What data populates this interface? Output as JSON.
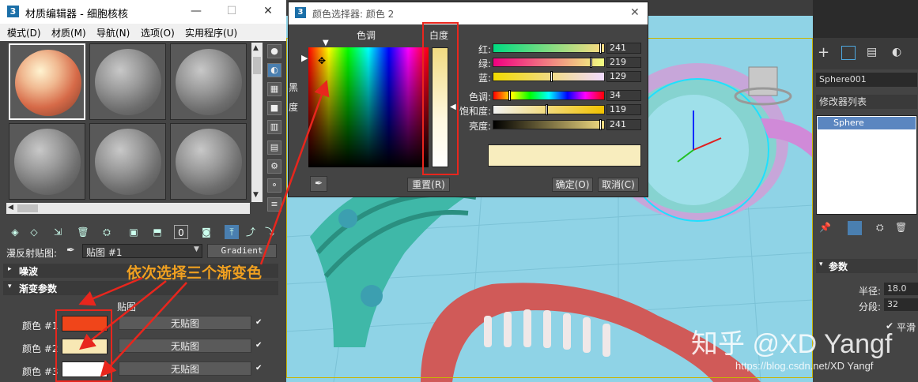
{
  "material_editor": {
    "title": "材质编辑器 - 细胞核核",
    "window_controls": [
      "—",
      "☐",
      "✕"
    ],
    "menu": [
      "模式(D)",
      "材质(M)",
      "导航(N)",
      "选项(O)",
      "实用程序(U)"
    ],
    "map_label": "漫反射贴图:",
    "map_name": "贴图 #1",
    "map_type": "Gradient",
    "rollout_noise": "噪波",
    "rollout_gradient": "渐变参数",
    "maps_header": "贴图",
    "color_rows": [
      {
        "label": "颜色 #1",
        "swatch": "#f0451a",
        "button": "无贴图"
      },
      {
        "label": "颜色 #2",
        "swatch": "#f8e8b4",
        "button": "无贴图"
      },
      {
        "label": "颜色 #3",
        "swatch": "#ffffff",
        "button": "无贴图"
      }
    ],
    "annotation": "依次选择三个渐变色",
    "annotation_color": "#f0a020"
  },
  "color_picker": {
    "title": "颜色选择器: 颜色 2",
    "hue_label": "色调",
    "whiteness_label": "白度",
    "blackness_label": "黑\n度",
    "sliders": [
      {
        "label": "红:",
        "value": "241"
      },
      {
        "label": "绿:",
        "value": "219"
      },
      {
        "label": "蓝:",
        "value": "129"
      },
      {
        "label": "色调:",
        "value": "34"
      },
      {
        "label": "饱和度:",
        "value": "119"
      },
      {
        "label": "亮度:",
        "value": "241"
      }
    ],
    "preview_color": "#f8edbe",
    "reset_label": "重置(R)",
    "ok_label": "确定(O)",
    "cancel_label": "取消(C)"
  },
  "command_panel": {
    "object_name": "Sphere001",
    "modifier_list": "修改器列表",
    "stack_item": "Sphere",
    "params_header": "参数",
    "radius_label": "半径:",
    "radius_value": "18.0",
    "segments_label": "分段:",
    "segments_value": "32",
    "smooth_label": "平滑"
  },
  "watermark": {
    "text": "知乎 @XD Yangf",
    "url": "https://blog.csdn.net/XD Yangf"
  }
}
